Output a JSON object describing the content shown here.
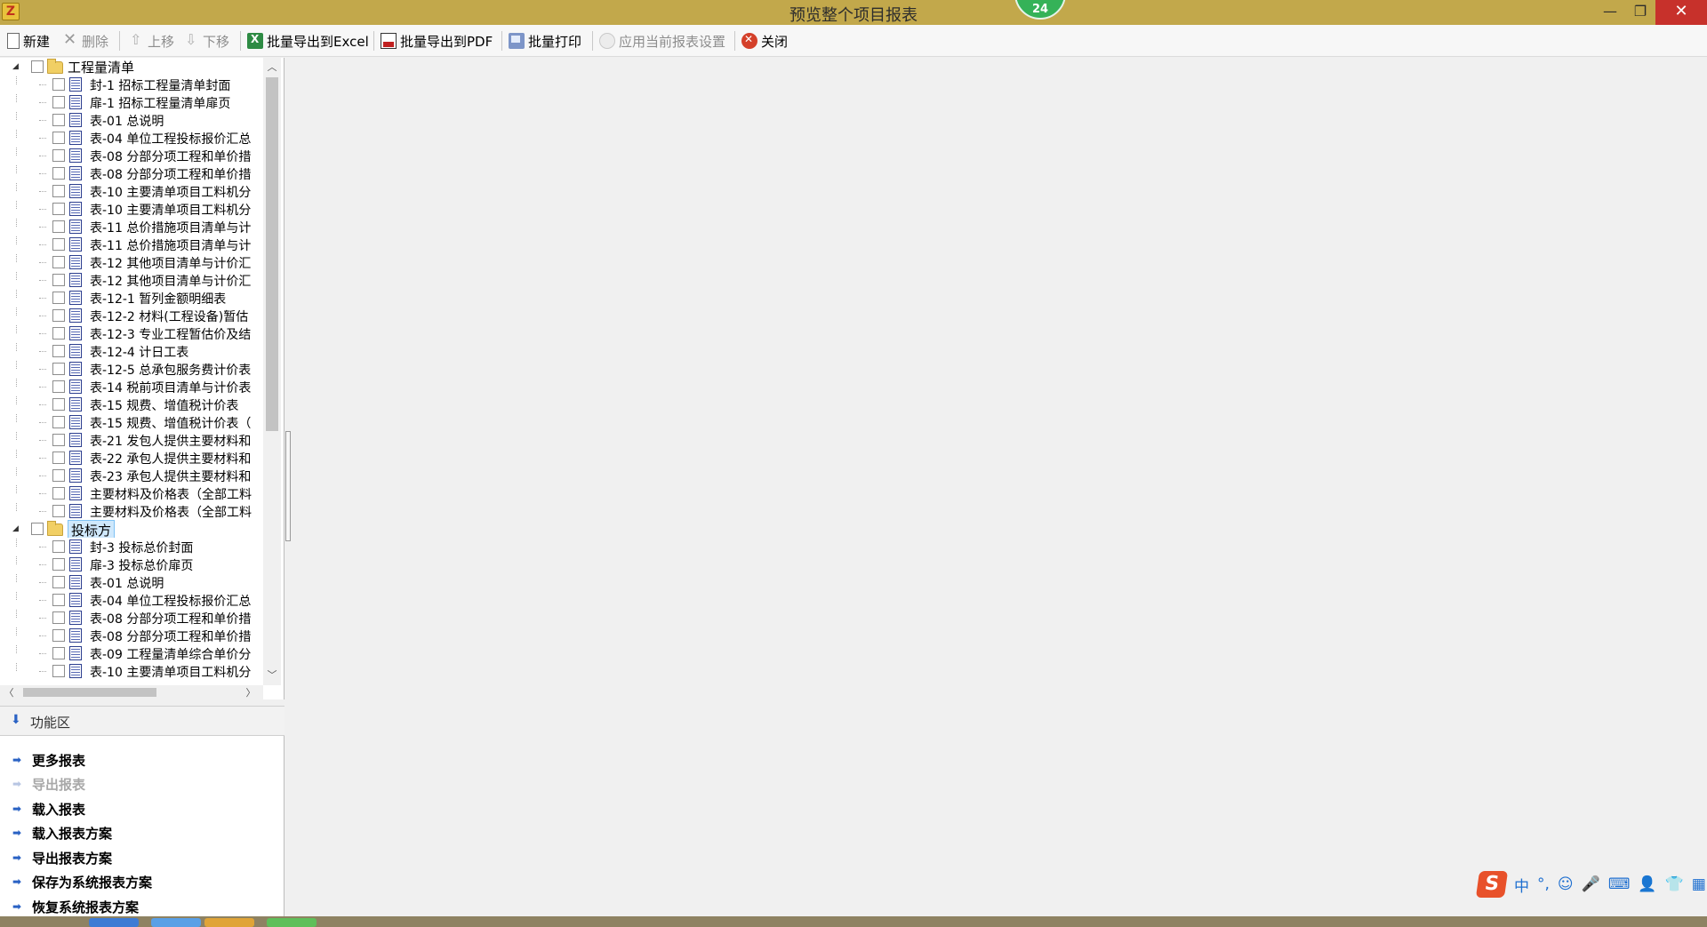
{
  "window": {
    "title": "预览整个项目报表",
    "badge": "24",
    "icon_glyph": "Z",
    "controls": {
      "minimize": "—",
      "maximize": "❐",
      "close": "✕"
    }
  },
  "toolbar": {
    "new": "新建",
    "delete": "删除",
    "move_up": "上移",
    "move_down": "下移",
    "export_excel": "批量导出到Excel",
    "export_pdf": "批量导出到PDF",
    "print": "批量打印",
    "apply_settings": "应用当前报表设置",
    "close": "关闭"
  },
  "tree": {
    "groups": [
      {
        "label": "工程量清单",
        "expander": "◢",
        "items": [
          "封-1 招标工程量清单封面",
          "扉-1 招标工程量清单扉页",
          "表-01 总说明",
          "表-04 单位工程投标报价汇总",
          "表-08 分部分项工程和单价措",
          "表-08 分部分项工程和单价措",
          "表-10 主要清单项目工料机分",
          "表-10 主要清单项目工料机分",
          "表-11 总价措施项目清单与计",
          "表-11 总价措施项目清单与计",
          "表-12 其他项目清单与计价汇",
          "表-12 其他项目清单与计价汇",
          "表-12-1 暂列金额明细表",
          "表-12-2 材料(工程设备)暂估",
          "表-12-3 专业工程暂估价及结",
          "表-12-4 计日工表",
          "表-12-5 总承包服务费计价表",
          "表-14 税前项目清单与计价表",
          "表-15 规费、增值税计价表",
          "表-15 规费、增值税计价表（",
          "表-21 发包人提供主要材料和",
          "表-22 承包人提供主要材料和",
          "表-23 承包人提供主要材料和",
          "主要材料及价格表（全部工料",
          "主要材料及价格表（全部工料"
        ]
      },
      {
        "label": "投标方",
        "expander": "◢",
        "items": [
          "封-3 投标总价封面",
          "扉-3 投标总价扉页",
          "表-01 总说明",
          "表-04 单位工程投标报价汇总",
          "表-08 分部分项工程和单价措",
          "表-08 分部分项工程和单价措",
          "表-09 工程量清单综合单价分",
          "表-10 主要清单项目工料机分"
        ]
      }
    ],
    "scroll": {
      "up": "︿",
      "down": "﹀",
      "left": "〈",
      "right": "〉"
    }
  },
  "function_area": {
    "title": "功能区",
    "items": [
      {
        "label": "更多报表",
        "enabled": true
      },
      {
        "label": "导出报表",
        "enabled": false
      },
      {
        "label": "载入报表",
        "enabled": true
      },
      {
        "label": "载入报表方案",
        "enabled": true
      },
      {
        "label": "导出报表方案",
        "enabled": true
      },
      {
        "label": "保存为系统报表方案",
        "enabled": true
      },
      {
        "label": "恢复系统报表方案",
        "enabled": true
      }
    ]
  },
  "ime": {
    "logo": "S",
    "icons": [
      "中",
      "°,",
      "☺",
      "🎤",
      "⌨",
      "👤",
      "👕",
      "▦"
    ]
  },
  "colors": {
    "titlebar": "#c2a84b",
    "close_button": "#c7312b",
    "badge": "#35b258",
    "link_arrow": "#2a62c4",
    "selection": "#cfe8fc"
  }
}
